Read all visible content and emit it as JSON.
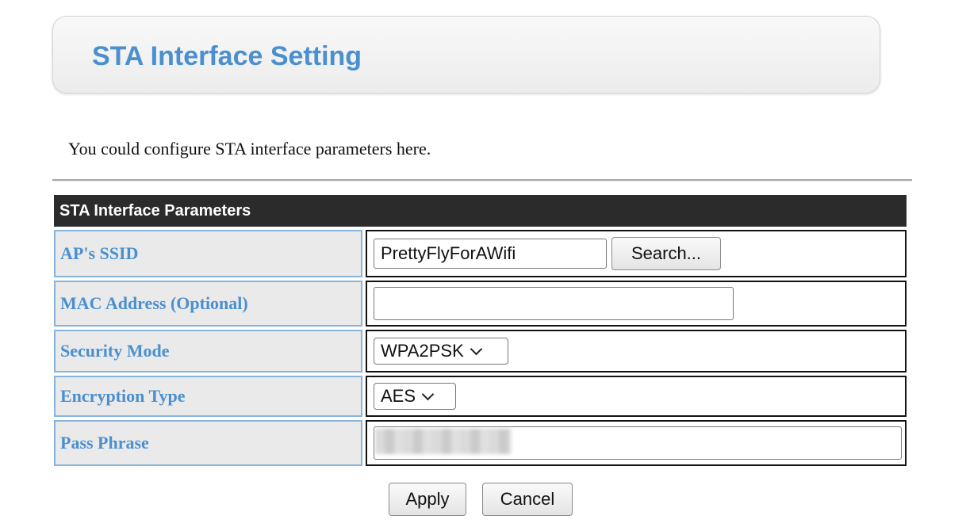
{
  "page": {
    "title": "STA Interface Setting",
    "description": "You could configure STA interface parameters here."
  },
  "table": {
    "header": "STA Interface Parameters",
    "rows": [
      {
        "label": "AP's SSID"
      },
      {
        "label": "MAC Address (Optional)"
      },
      {
        "label": "Security Mode"
      },
      {
        "label": "Encryption Type"
      },
      {
        "label": "Pass Phrase"
      }
    ]
  },
  "fields": {
    "ssid_value": "PrettyFlyForAWifi",
    "search_label": "Search...",
    "mac_value": "",
    "security_mode": "WPA2PSK",
    "encryption_type": "AES",
    "passphrase_value": ""
  },
  "actions": {
    "apply_label": "Apply",
    "cancel_label": "Cancel"
  },
  "colors": {
    "title": "#4a8fd0",
    "label_text": "#4a8fd0",
    "label_border": "#88b3dc",
    "header_bg": "#2b2b2b"
  },
  "icons": {
    "select_arrow": "chevron-down-icon"
  }
}
